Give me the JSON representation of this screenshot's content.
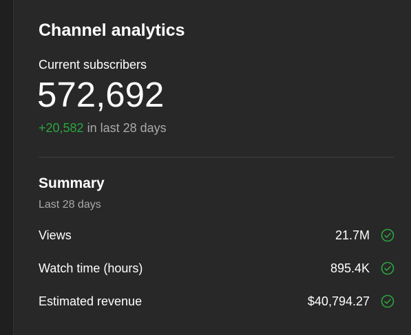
{
  "header": {
    "title": "Channel analytics"
  },
  "subscribers": {
    "label": "Current subscribers",
    "count": "572,692",
    "delta": "+20,582",
    "delta_suffix": " in last 28 days"
  },
  "summary": {
    "title": "Summary",
    "period": "Last 28 days",
    "metrics": [
      {
        "name": "Views",
        "value": "21.7M",
        "status_icon": "check-circle-icon"
      },
      {
        "name": "Watch time (hours)",
        "value": "895.4K",
        "status_icon": "check-circle-icon"
      },
      {
        "name": "Estimated revenue",
        "value": "$40,794.27",
        "status_icon": "check-circle-icon"
      }
    ]
  },
  "colors": {
    "background": "#1f1f1f",
    "card": "#282828",
    "positive_green": "#2ba640",
    "muted_text": "#aaaaaa"
  }
}
